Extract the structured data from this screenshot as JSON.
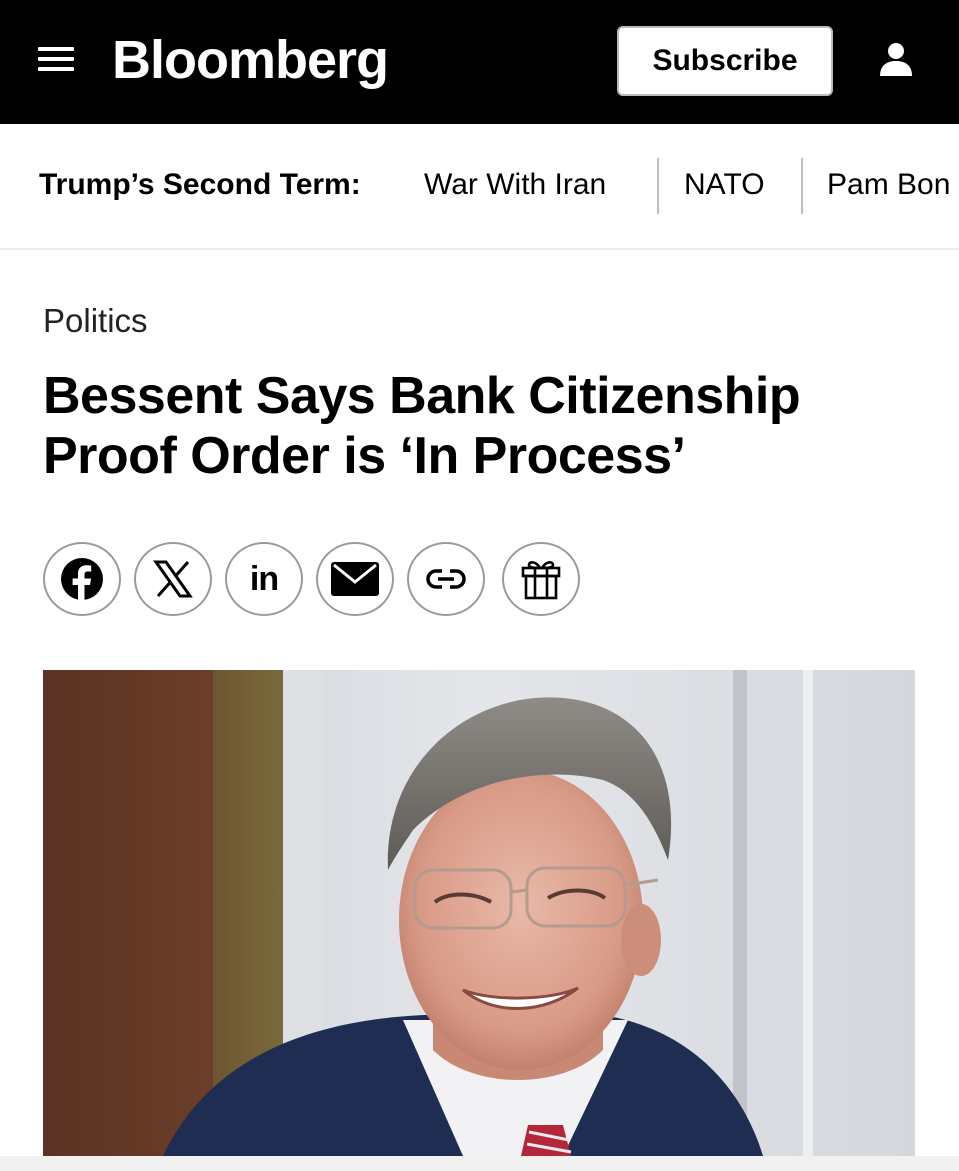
{
  "header": {
    "logo": "Bloomberg",
    "subscribe_label": "Subscribe"
  },
  "nav": {
    "title": "Trump’s Second Term:",
    "items": [
      "War With Iran",
      "NATO",
      "Pam Bon"
    ]
  },
  "article": {
    "section": "Politics",
    "headline_line1": "Bessent Says Bank Citizenship",
    "headline_line2": "Proof Order is ‘In Process’"
  },
  "share": {
    "buttons": [
      {
        "icon": "facebook-icon"
      },
      {
        "icon": "x-icon"
      },
      {
        "icon": "linkedin-icon",
        "label": "in"
      },
      {
        "icon": "email-icon"
      },
      {
        "icon": "link-icon"
      },
      {
        "icon": "gift-icon"
      }
    ]
  },
  "colors": {
    "header_bg": "#000000",
    "header_text": "#ffffff",
    "border": "#9a9a9a"
  }
}
